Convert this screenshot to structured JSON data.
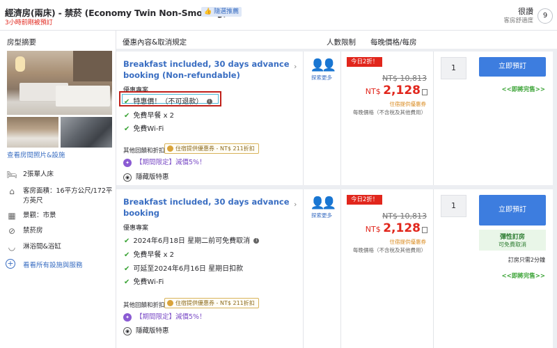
{
  "header": {
    "title": "經濟房(兩床) - 禁菸 (Economy Twin Non-Smoking)",
    "recommend_badge": "👍 隨選推薦",
    "recent_booked": "3小時前剛被預訂",
    "rating_word": "很讚",
    "rating_sub": "客房舒適度",
    "rating_score": "9"
  },
  "columns": {
    "room_overview": "房型摘要",
    "offer": "優惠內容&取消規定",
    "occupancy": "人數限制",
    "price": "每晚價格/每房"
  },
  "left": {
    "view_photos": "查看房間照片&設施",
    "features": [
      {
        "icon": "bed-icon",
        "text": "2張單人床"
      },
      {
        "icon": "room-size-icon",
        "text": "客房面積：16平方公尺/172平方英尺"
      },
      {
        "icon": "view-icon",
        "text": "景觀：市景"
      },
      {
        "icon": "no-smoking-icon",
        "text": "禁菸房"
      },
      {
        "icon": "bathtub-icon",
        "text": "淋浴間&浴缸"
      }
    ],
    "amenities_link": "看看所有設施與服務"
  },
  "offers": [
    {
      "title": "Breakfast included, 30 days advance booking (Non-refundable)",
      "subtitle": "優惠專案",
      "benefits": [
        "特惠價！（不可退款）",
        "免費早餐 x 2",
        "免費Wi-Fi"
      ],
      "other_label": "其他回饋和折扣",
      "coupon": "住宿提供優惠券 - NT$ 211折扣",
      "promo": "【期間限定】減價5%！",
      "secret": "隱藏版特惠",
      "occupancy_link": "探索更多",
      "discount_badge": "今日2折！",
      "original_price": "NT$ 10,813",
      "currency": "NT$",
      "price": "2,128",
      "member_note": "住宿提供優惠券",
      "price_note": "每晚價格（不含稅及其他費用）",
      "quantity": "1",
      "book_label": "立即預訂",
      "sellout": "<<即將完售>>"
    },
    {
      "title": "Breakfast included, 30 days advance booking",
      "subtitle": "優惠專案",
      "benefits": [
        "2024年6月18日 星期二前可免費取消",
        "免費早餐 x 2",
        "可延至2024年6月16日 星期日扣款",
        "免費Wi-Fi"
      ],
      "other_label": "其他回饋和折扣",
      "coupon": "住宿提供優惠券 - NT$ 211折扣",
      "promo": "【期間限定】減價5%！",
      "secret": "隱藏版特惠",
      "occupancy_link": "探索更多",
      "discount_badge": "今日2折！",
      "original_price": "NT$ 10,813",
      "currency": "NT$",
      "price": "2,128",
      "member_note": "住宿提供優惠券",
      "price_note": "每晚價格（不含稅及其他費用）",
      "quantity": "1",
      "book_label": "立即預訂",
      "flex_title": "彈性訂房",
      "flex_sub": "可免費取消",
      "remain": "訂房只需2分鐘",
      "sellout": "<<即將完售>>"
    }
  ]
}
